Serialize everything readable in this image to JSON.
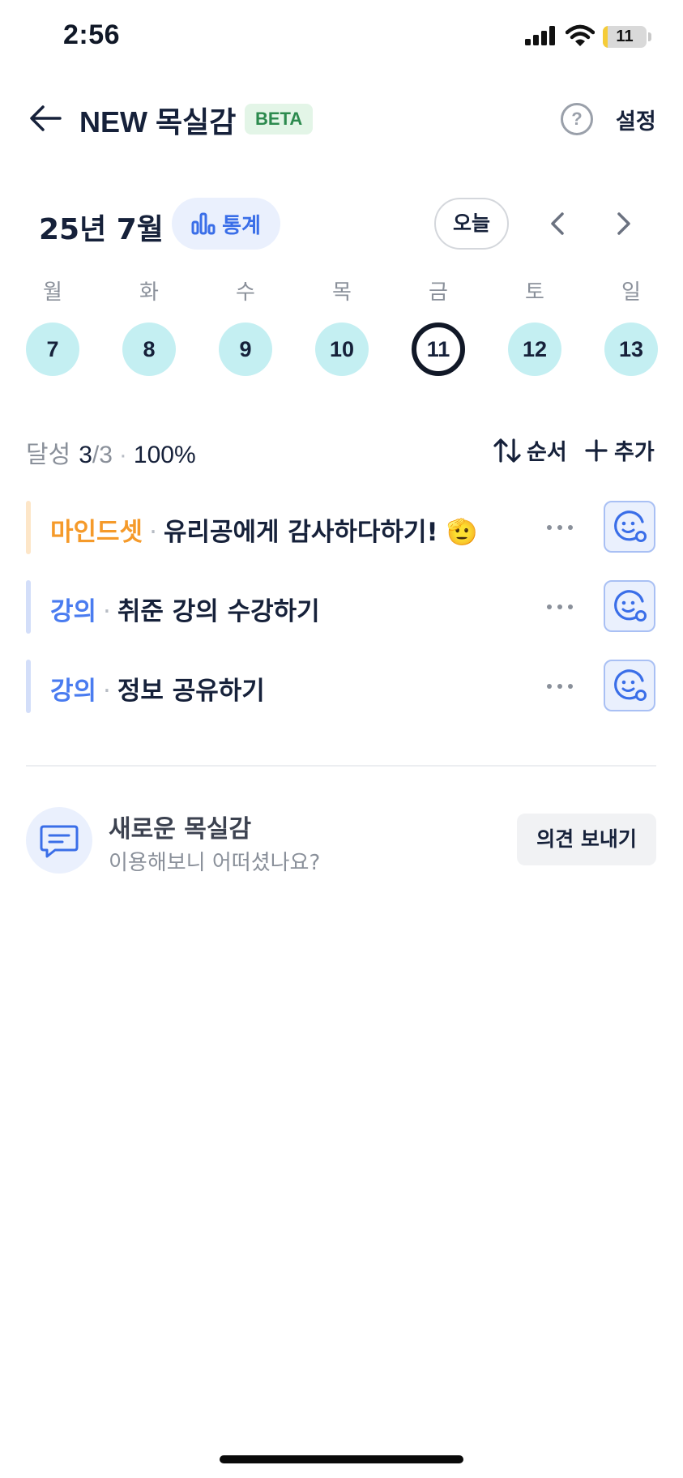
{
  "status_bar": {
    "time": "2:56",
    "battery_level": "11",
    "battery_fill_pct": 11,
    "battery_fill_color": "#f5cc38"
  },
  "header": {
    "title": "NEW 목실감",
    "badge": "BETA",
    "help_icon": "?",
    "settings_label": "설정",
    "back_icon": "arrow-left-icon"
  },
  "calendar": {
    "month_label": "25년 7월",
    "stats_label": "통계",
    "today_label": "오늘",
    "weekdays": [
      "월",
      "화",
      "수",
      "목",
      "금",
      "토",
      "일"
    ],
    "days": [
      "7",
      "8",
      "9",
      "10",
      "11",
      "12",
      "13"
    ],
    "selected_day": "11",
    "day_color": "#c4eff2"
  },
  "summary": {
    "label": "달성",
    "done": "3",
    "slash": "/",
    "total": "3",
    "separator": "·",
    "percent": "100%",
    "sort_label": "순서",
    "add_label": "추가"
  },
  "tasks": [
    {
      "category": "마인드셋",
      "separator": "·",
      "title": "유리공에게 감사하다하기! 🫡",
      "color": "#f59a2a",
      "bar_color": "#fde6c8"
    },
    {
      "category": "강의",
      "separator": "·",
      "title": "취준 강의 수강하기",
      "color": "#4a7cf0",
      "bar_color": "#d3def9"
    },
    {
      "category": "강의",
      "separator": "·",
      "title": "정보 공유하기",
      "color": "#4a7cf0",
      "bar_color": "#d3def9"
    }
  ],
  "feedback": {
    "title": "새로운 목실감",
    "subtitle": "이용해보니 어떠셨나요?",
    "button_label": "의견 보내기"
  }
}
